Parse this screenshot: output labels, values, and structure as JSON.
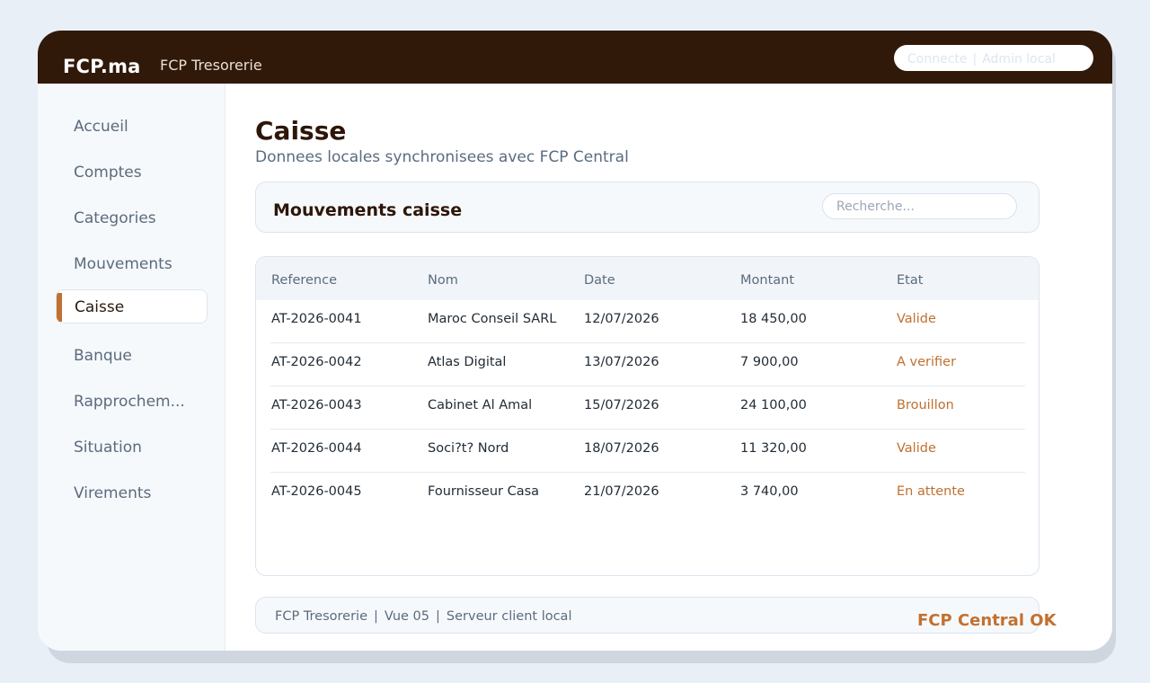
{
  "app": {
    "brand": "FCP.ma",
    "title": "FCP Tresorerie",
    "status_label": "Connecte",
    "user_label": "Admin local"
  },
  "sidebar": {
    "items": [
      {
        "label": "Accueil",
        "active": false
      },
      {
        "label": "Comptes",
        "active": false
      },
      {
        "label": "Categories",
        "active": false
      },
      {
        "label": "Mouvements",
        "active": false
      },
      {
        "label": "Caisse",
        "active": true
      },
      {
        "label": "Banque",
        "active": false
      },
      {
        "label": "Rapprochem...",
        "active": false
      },
      {
        "label": "Situation",
        "active": false
      },
      {
        "label": "Virements",
        "active": false
      }
    ]
  },
  "page": {
    "title": "Caisse",
    "subtitle": "Donnees locales synchronisees avec FCP Central"
  },
  "section": {
    "title": "Mouvements caisse",
    "search_placeholder": "Recherche..."
  },
  "table": {
    "columns": [
      "Reference",
      "Nom",
      "Date",
      "Montant",
      "Etat"
    ],
    "rows": [
      [
        "AT-2026-0041",
        "Maroc Conseil SARL",
        "12/07/2026",
        "18 450,00",
        "Valide"
      ],
      [
        "AT-2026-0042",
        "Atlas Digital",
        "13/07/2026",
        "7 900,00",
        "A verifier"
      ],
      [
        "AT-2026-0043",
        "Cabinet Al Amal",
        "15/07/2026",
        "24 100,00",
        "Brouillon"
      ],
      [
        "AT-2026-0044",
        "Soci?t? Nord",
        "18/07/2026",
        "11 320,00",
        "Valide"
      ],
      [
        "AT-2026-0045",
        "Fournisseur Casa",
        "21/07/2026",
        "3 740,00",
        "En attente"
      ]
    ]
  },
  "footer": {
    "product": "FCP Tresorerie",
    "view": "Vue 05",
    "server": "Serveur client local",
    "status": "FCP Central OK"
  },
  "colors": {
    "topbar": "#311909",
    "accent": "#c3702f",
    "background": "#e8eff7"
  }
}
